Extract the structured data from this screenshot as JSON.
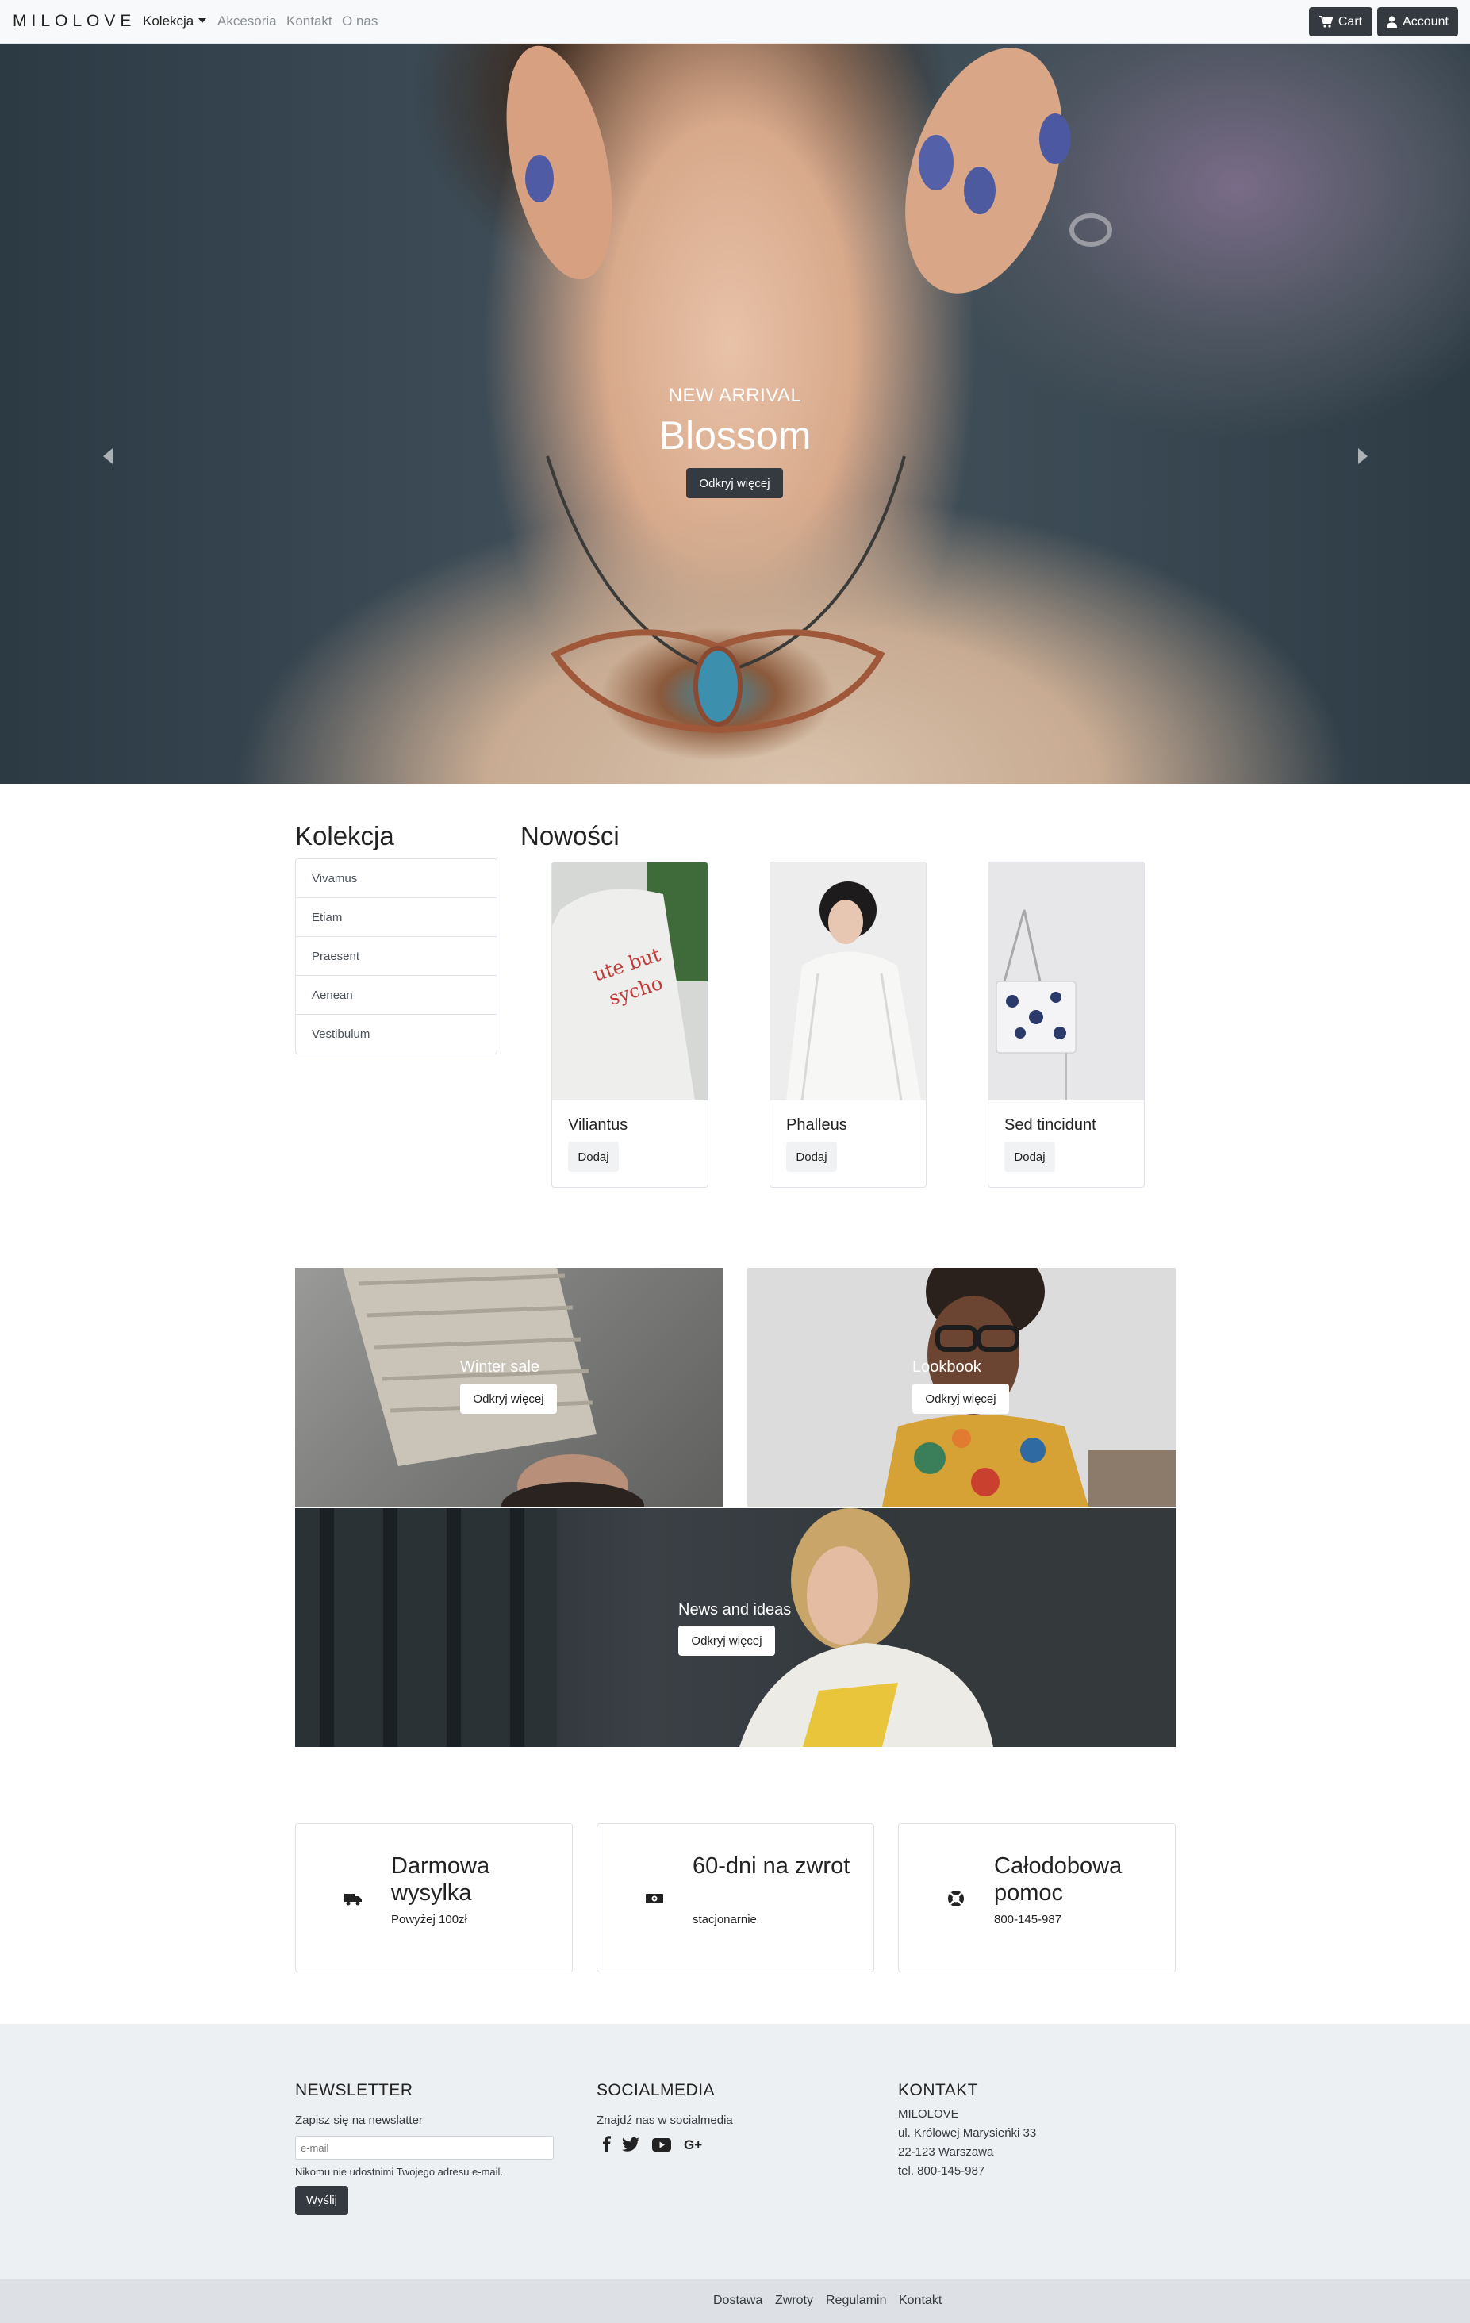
{
  "nav": {
    "brand": "MILOLOVE",
    "links": [
      "Kolekcja",
      "Akcesoria",
      "Kontakt",
      "O nas"
    ],
    "cart": "Cart",
    "account": "Account"
  },
  "hero": {
    "subtitle": "NEW ARRIVAL",
    "title": "Blossom",
    "button": "Odkryj więcej"
  },
  "sidebar": {
    "title": "Kolekcja",
    "items": [
      "Vivamus",
      "Etiam",
      "Praesent",
      "Aenean",
      "Vestibulum"
    ]
  },
  "products": {
    "title": "Nowości",
    "items": [
      {
        "name": "Viliantus",
        "button": "Dodaj"
      },
      {
        "name": "Phalleus",
        "button": "Dodaj"
      },
      {
        "name": "Sed tincidunt",
        "button": "Dodaj"
      }
    ]
  },
  "tiles": [
    {
      "label": "Winter sale",
      "button": "Odkryj więcej"
    },
    {
      "label": "Lookbook",
      "button": "Odkryj więcej"
    },
    {
      "label": "News and ideas",
      "button": "Odkryj więcej"
    }
  ],
  "features": [
    {
      "title": "Darmowa wysylka",
      "subtitle": "Powyżej 100zł",
      "icon": "truck-icon"
    },
    {
      "title": "60-dni na zwrot",
      "subtitle": "stacjonarnie",
      "icon": "money-icon"
    },
    {
      "title": "Całodobowa pomoc",
      "subtitle": "800-145-987",
      "icon": "life-ring-icon"
    }
  ],
  "footer": {
    "newsletter": {
      "title": "NEWSLETTER",
      "text": "Zapisz się na newslatter",
      "placeholder": "e-mail",
      "note": "Nikomu nie udostnimi Twojego adresu e-mail.",
      "button": "Wyślij"
    },
    "social": {
      "title": "SOCIALMEDIA",
      "text": "Znajdź nas w socialmedia",
      "icons": [
        "facebook-icon",
        "twitter-icon",
        "youtube-icon",
        "google-plus-icon"
      ]
    },
    "contact": {
      "title": "KONTAKT",
      "lines": [
        "MILOLOVE",
        "ul. Królowej Marysieńki 33",
        "22-123 Warszawa",
        "tel. 800-145-987"
      ]
    },
    "bottom_links": [
      "Dostawa",
      "Zwroty",
      "Regulamin",
      "Kontakt"
    ]
  }
}
